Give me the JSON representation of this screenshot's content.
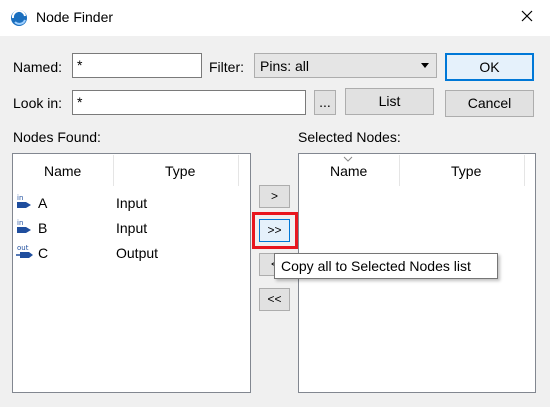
{
  "window": {
    "title": "Node Finder"
  },
  "named": {
    "label": "Named:",
    "value": "*"
  },
  "filter": {
    "label": "Filter:",
    "selected": "Pins: all"
  },
  "look_in": {
    "label": "Look in:",
    "value": "*",
    "browse_label": "..."
  },
  "buttons": {
    "ok": "OK",
    "list": "List",
    "cancel": "Cancel"
  },
  "nodes_found": {
    "label": "Nodes Found:",
    "columns": [
      "Name",
      "Type"
    ],
    "rows": [
      {
        "pin_tag": "in",
        "name": "A",
        "type": "Input"
      },
      {
        "pin_tag": "in",
        "name": "B",
        "type": "Input"
      },
      {
        "pin_tag": "out",
        "name": "C",
        "type": "Output"
      }
    ]
  },
  "selected_nodes": {
    "label": "Selected Nodes:",
    "columns": [
      "Name",
      "Type"
    ]
  },
  "transfer": {
    "copy_one": ">",
    "copy_all": ">>",
    "remove_one": "<",
    "remove_all": "<<"
  },
  "tooltip": {
    "text": "Copy all to Selected Nodes list"
  },
  "colors": {
    "highlight": "#e8161e",
    "accent": "#0078d7",
    "pin_icon": "#1f4e9e"
  }
}
